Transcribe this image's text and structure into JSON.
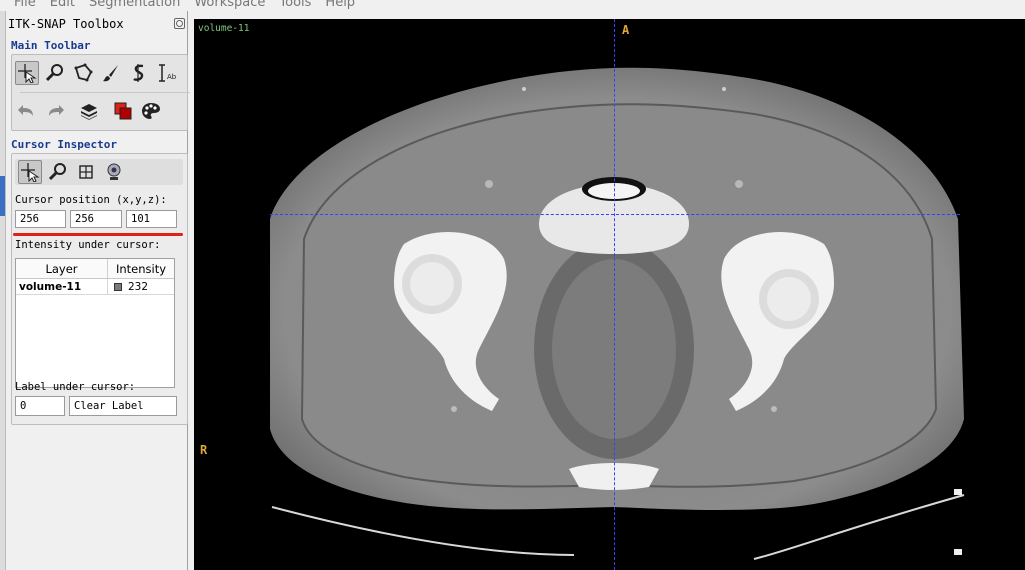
{
  "menu": [
    "File",
    "Edit",
    "Segmentation",
    "Workspace",
    "Tools",
    "Help"
  ],
  "toolbox": {
    "title": "ITK-SNAP Toolbox",
    "main_toolbar_label": "Main Toolbar",
    "tools_row1": [
      "crosshair-cursor-icon",
      "zoom-icon",
      "polygon-icon",
      "paintbrush-icon",
      "snake-icon",
      "annotation-icon"
    ],
    "tools_row2": [
      "undo-icon",
      "redo-icon",
      "layers-icon",
      "label-colors-icon",
      "palette-icon"
    ]
  },
  "cursor_inspector": {
    "title": "Cursor Inspector",
    "position_label": "Cursor position (x,y,z):",
    "x": "256",
    "y": "256",
    "z": "101",
    "intensity_label": "Intensity under cursor:",
    "columns": [
      "Layer",
      "Intensity"
    ],
    "rows": [
      {
        "layer": "volume-11",
        "intensity": "232"
      }
    ],
    "label_under_cursor_label": "Label under cursor:",
    "label_id": "0",
    "label_name": "Clear Label"
  },
  "viewer": {
    "layer_name": "volume-11",
    "orientation_top": "A",
    "orientation_left": "R"
  },
  "colors": {
    "accent_red": "#e0201b",
    "crosshair": "#3d3dff",
    "section_blue": "#1a3a8f"
  }
}
